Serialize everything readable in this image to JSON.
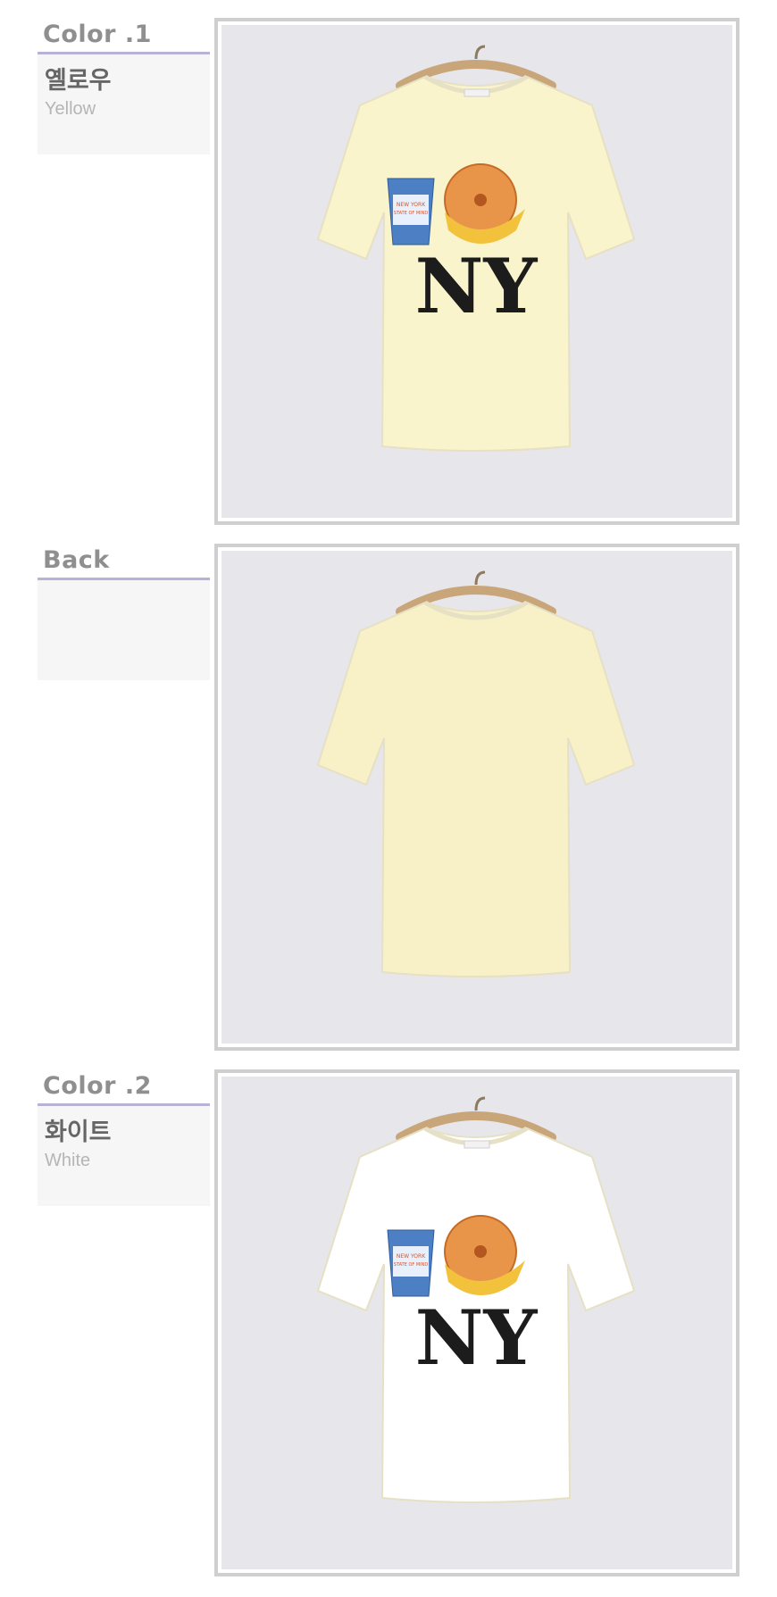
{
  "sections": [
    {
      "title": "Color .1",
      "korean": "옐로우",
      "english": "Yellow",
      "shirt_color": "#faf4cc",
      "view": "front",
      "photo_name": "yellow-tshirt-front-photo"
    },
    {
      "title": "Back",
      "korean": "",
      "english": "",
      "shirt_color": "#f8f1c8",
      "view": "back",
      "photo_name": "yellow-tshirt-back-photo"
    },
    {
      "title": "Color .2",
      "korean": "화이트",
      "english": "White",
      "shirt_color": "#ffffff",
      "view": "front",
      "photo_name": "white-tshirt-front-photo"
    }
  ],
  "print_text": "NY",
  "cup_text": [
    "NEW YORK",
    "STATE OF MIND"
  ],
  "colors": {
    "accent_underline": "#b9b2d6",
    "label_title": "#8f8f8f",
    "label_box_bg": "#f6f6f6",
    "photo_bg": "#e7e6ea",
    "frame_border": "#cfcfcf"
  }
}
